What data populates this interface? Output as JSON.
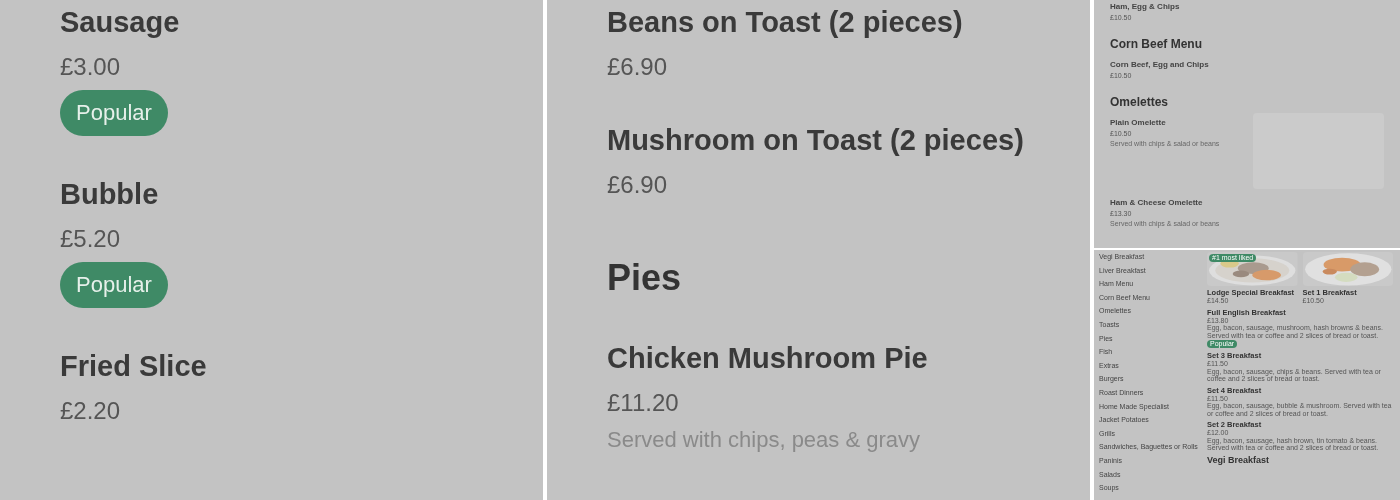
{
  "panels": [
    {
      "kind": "large",
      "entries": [
        {
          "kind": "item",
          "name": "Sausage",
          "price": "£3.00",
          "badge": "Popular"
        },
        {
          "kind": "item",
          "name": "Bubble",
          "price": "£5.20",
          "badge": "Popular"
        },
        {
          "kind": "item",
          "name": "Fried Slice",
          "price": "£2.20"
        }
      ]
    },
    {
      "kind": "large",
      "entries": [
        {
          "kind": "item",
          "name": "Beans on Toast (2 pieces)",
          "price": "£6.90"
        },
        {
          "kind": "item",
          "name": "Mushroom on Toast (2 pieces)",
          "price": "£6.90"
        },
        {
          "kind": "heading",
          "name": "Pies"
        },
        {
          "kind": "item",
          "name": "Chicken Mushroom Pie",
          "price": "£11.20",
          "description": "Served with chips, peas & gravy"
        }
      ]
    },
    {
      "kind": "small",
      "entries": [
        {
          "kind": "item",
          "name": "Ham, Egg & Chips",
          "price": "£10.50"
        },
        {
          "kind": "heading",
          "name": "Corn Beef Menu"
        },
        {
          "kind": "item",
          "name": "Corn Beef, Egg and Chips",
          "price": "£10.50"
        },
        {
          "kind": "heading",
          "name": "Omelettes"
        },
        {
          "kind": "image_item",
          "name": "Plain Omelette",
          "price": "£10.50",
          "description": "Served with chips & salad or beans"
        },
        {
          "kind": "item",
          "name": "Ham & Cheese Omelette",
          "price": "£13.30",
          "description": "Served with chips & salad or beans"
        }
      ]
    },
    {
      "kind": "tiny",
      "sidebar": [
        "Vegi Breakfast",
        "Liver Breakfast",
        "Ham Menu",
        "Corn Beef Menu",
        "Omelettes",
        "Toasts",
        "Pies",
        "Fish",
        "Extras",
        "Burgers",
        "Roast Dinners",
        "Home Made Specialist",
        "Jacket Potatoes",
        "Grills",
        "Sandwiches, Baguettes or Rolls",
        "Paninis",
        "Salads",
        "Soups"
      ],
      "featured": [
        {
          "name": "Lodge Special Breakfast",
          "price": "£14.50",
          "badge": "#1 most liked",
          "kind": "picture"
        },
        {
          "name": "Set 1 Breakfast",
          "price": "£10.50",
          "kind": "picture"
        }
      ],
      "entries": [
        {
          "kind": "item",
          "name": "Full English Breakfast",
          "price": "£13.80",
          "description": "Egg, bacon, sausage, mushroom, hash browns & beans. Served with tea or coffee and 2 slices of bread or toast.",
          "badge": "Popular"
        },
        {
          "kind": "item",
          "name": "Set 3 Breakfast",
          "price": "£11.50",
          "description": "Egg, bacon, sausage, chips & beans. Served with tea or coffee and 2 slices of bread or toast."
        },
        {
          "kind": "item",
          "name": "Set 4 Breakfast",
          "price": "£11.50",
          "description": "Egg, bacon, sausage, bubble & mushroom. Served with tea or coffee and 2 slices of bread or toast."
        },
        {
          "kind": "item",
          "name": "Set 2 Breakfast",
          "price": "£12.00",
          "description": "Egg, bacon, sausage, hash brown, tin tomato & beans. Served with tea or coffee and 2 slices of bread or toast."
        },
        {
          "kind": "heading",
          "name": "Vegi Breakfast"
        }
      ]
    }
  ]
}
